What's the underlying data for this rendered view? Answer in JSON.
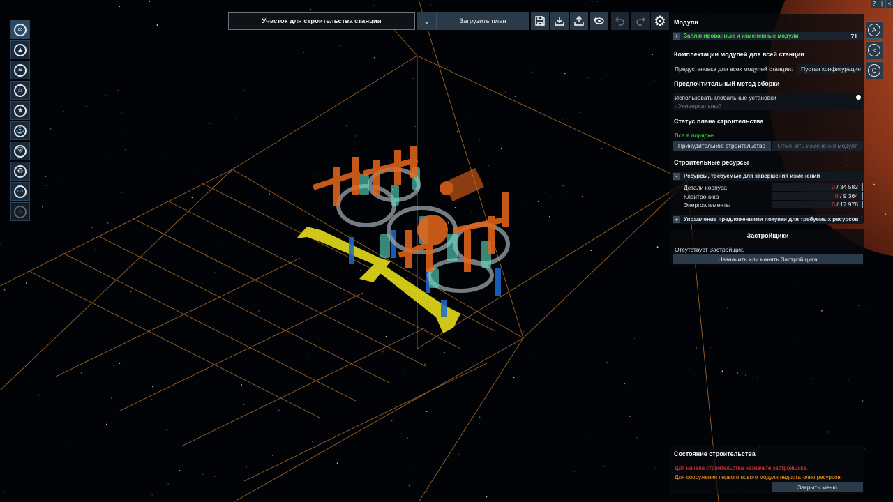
{
  "toolbar": {
    "site_title": "Участок для строительства станции",
    "load_plan": "Загрузить план",
    "buttons": [
      "save-icon",
      "download-icon",
      "export-icon",
      "view-reset-icon",
      "undo-icon",
      "redo-icon",
      "gear-icon"
    ]
  },
  "left_bar": {
    "items": [
      "infinity-icon",
      "map-icon",
      "list-icon",
      "home-icon",
      "star-icon",
      "anchor-icon",
      "shield-icon",
      "recycle-icon",
      "more-icon",
      "disabled-icon"
    ]
  },
  "right_bar": {
    "items": [
      "A",
      "<",
      "C"
    ]
  },
  "window_buttons": [
    "?",
    "|",
    "<"
  ],
  "panel": {
    "modules": {
      "title": "Модули",
      "planned_label": "Запланированные и измененные модули",
      "planned_count": "71"
    },
    "loadouts": {
      "title": "Комплектации модулей для всей станции",
      "preset_label": "Предустановка для всех модулей станции:",
      "preset_value": "Пустая конфигурация"
    },
    "build_method": {
      "title": "Предпочтительный метод сборки",
      "use_global": "Использовать глобальные установки",
      "universal": "- Универсальный"
    },
    "plan_status": {
      "title": "Статус плана строительства",
      "status": "Все в порядке.",
      "force_build": "Принудительное строительство",
      "cancel_changes": "Отменить изменения модуля"
    },
    "resources": {
      "title": "Строительные ресурсы",
      "required_label": "Ресурсы, требуемые для завершения изменений",
      "items": [
        {
          "name": "Детали корпуса",
          "have": "0",
          "need": " / 34 582"
        },
        {
          "name": "Клэйтроника",
          "have": "0",
          "need": " / 9 364"
        },
        {
          "name": "Энергоэлементы",
          "have": "0",
          "need": " / 17 978"
        }
      ],
      "offers_label": "Управление предложениями покупки для требуемых ресурсов"
    },
    "builders": {
      "title": "Застройщики",
      "none": "Отсутствует Застройщик.",
      "assign": "Назначить или нанять Застройщика"
    }
  },
  "build_status": {
    "title": "Состояние строительства",
    "error1": "Для начала строительства назначьте застройщика.",
    "error2": "Для сооружения первого нового модуля недостаточно ресурсов.",
    "close": "Закрыть меню"
  },
  "colors": {
    "accent": "#2b3a49",
    "ok": "#42e04c",
    "error": "#ff3b3b",
    "warning": "#ffa21e",
    "grid": "#c07a2a",
    "module_orange": "#e8661a",
    "module_cyan": "#5fe0c8",
    "module_yellow": "#e8e020",
    "module_blue": "#1e6bd0"
  }
}
